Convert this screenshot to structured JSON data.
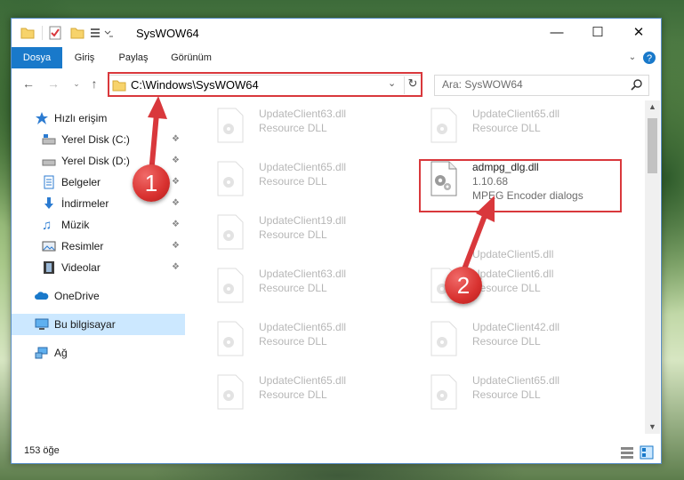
{
  "window": {
    "title": "SysWOW64"
  },
  "ribbon": {
    "tabs": [
      "Dosya",
      "Giriş",
      "Paylaş",
      "Görünüm"
    ]
  },
  "address": {
    "path": "C:\\Windows\\SysWOW64"
  },
  "search": {
    "placeholder": "Ara: SysWOW64"
  },
  "sidebar": {
    "items": [
      {
        "label": "Hızlı erişim"
      },
      {
        "label": "Yerel Disk (C:)"
      },
      {
        "label": "Yerel Disk (D:)"
      },
      {
        "label": "Belgeler"
      },
      {
        "label": "İndirmeler"
      },
      {
        "label": "Müzik"
      },
      {
        "label": "Resimler"
      },
      {
        "label": "Videolar"
      },
      {
        "label": "OneDrive"
      },
      {
        "label": "Bu bilgisayar"
      },
      {
        "label": "Ağ"
      }
    ]
  },
  "files": {
    "left": [
      {
        "name": "UpdateClient63.dll",
        "type": "Resource DLL"
      },
      {
        "name": "UpdateClient65.dll",
        "type": "Resource DLL"
      },
      {
        "name": "UpdateClient19.dll",
        "type": "Resource DLL"
      },
      {
        "name": "UpdateClient63.dll",
        "type": "Resource DLL"
      },
      {
        "name": "UpdateClient65.dll",
        "type": "Resource DLL"
      },
      {
        "name": "UpdateClient65.dll",
        "type": "Resource DLL"
      }
    ],
    "right": [
      {
        "name": "UpdateClient65.dll",
        "type": "Resource DLL"
      },
      {
        "name": "UpdateClient5.dll",
        "type": "Resource DLL"
      },
      {
        "name": "UpdateClient6.dll",
        "type": "Resource DLL"
      },
      {
        "name": "UpdateClient42.dll",
        "type": "Resource DLL"
      },
      {
        "name": "UpdateClient65.dll",
        "type": "Resource DLL"
      }
    ],
    "highlight": {
      "name": "admpg_dlg.dll",
      "version": "1.10.68",
      "description": "MPEG Encoder dialogs"
    }
  },
  "status": {
    "count": "153 öğe"
  },
  "callouts": [
    "1",
    "2"
  ],
  "colors": {
    "accent": "#1979ca",
    "highlight_box": "#d9383c",
    "selected_nav": "#cce8ff"
  }
}
